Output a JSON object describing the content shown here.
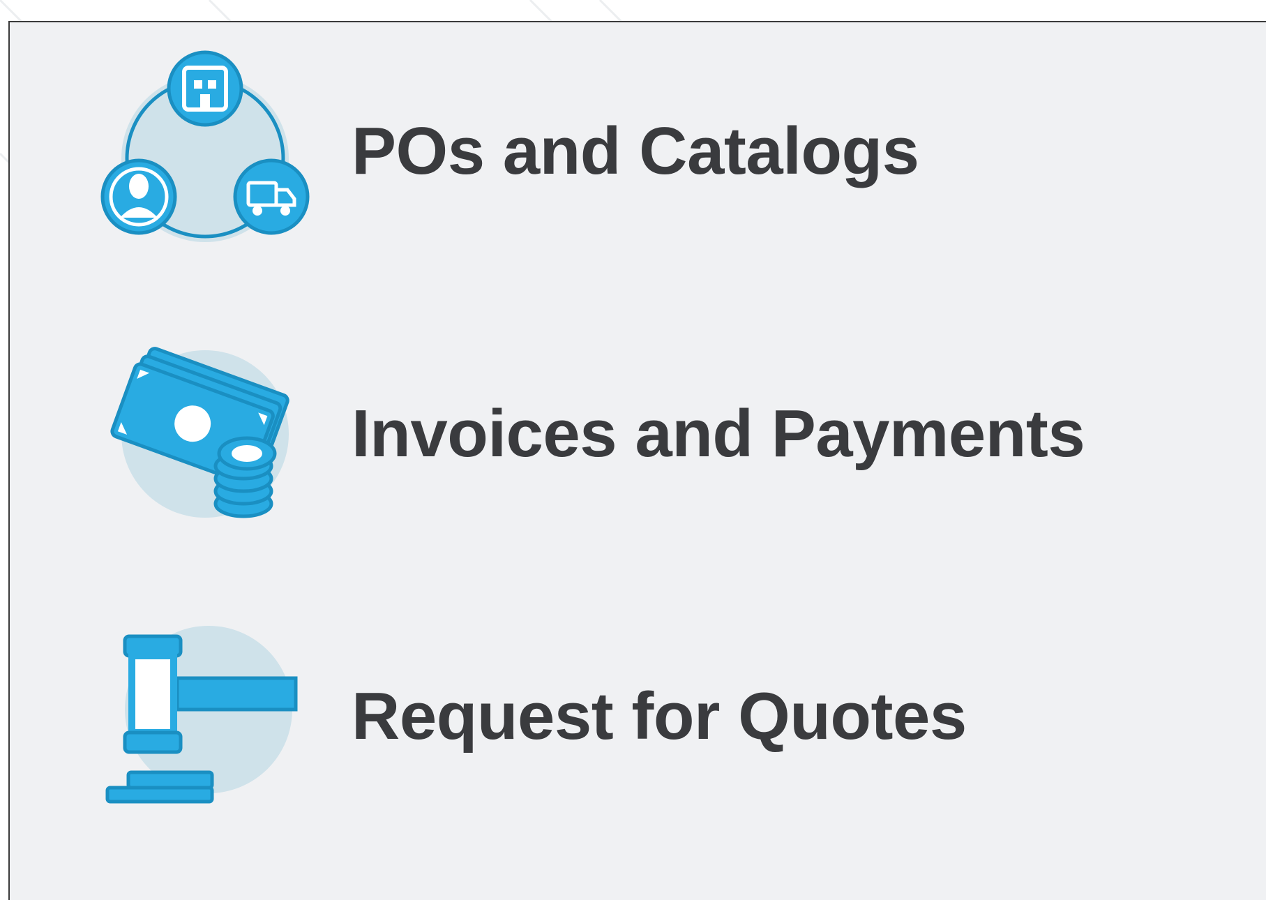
{
  "menu": {
    "items": [
      {
        "label": "POs and Catalogs",
        "icon": "supplier-network-icon"
      },
      {
        "label": "Invoices and Payments",
        "icon": "money-coins-icon"
      },
      {
        "label": "Request for Quotes",
        "icon": "gavel-icon"
      }
    ]
  },
  "colors": {
    "icon_blue": "#29abe2",
    "icon_outline": "#1a8fc2",
    "icon_circle": "#cfe2ea",
    "text": "#3a3b3e",
    "panel_bg": "#f0f1f3"
  }
}
